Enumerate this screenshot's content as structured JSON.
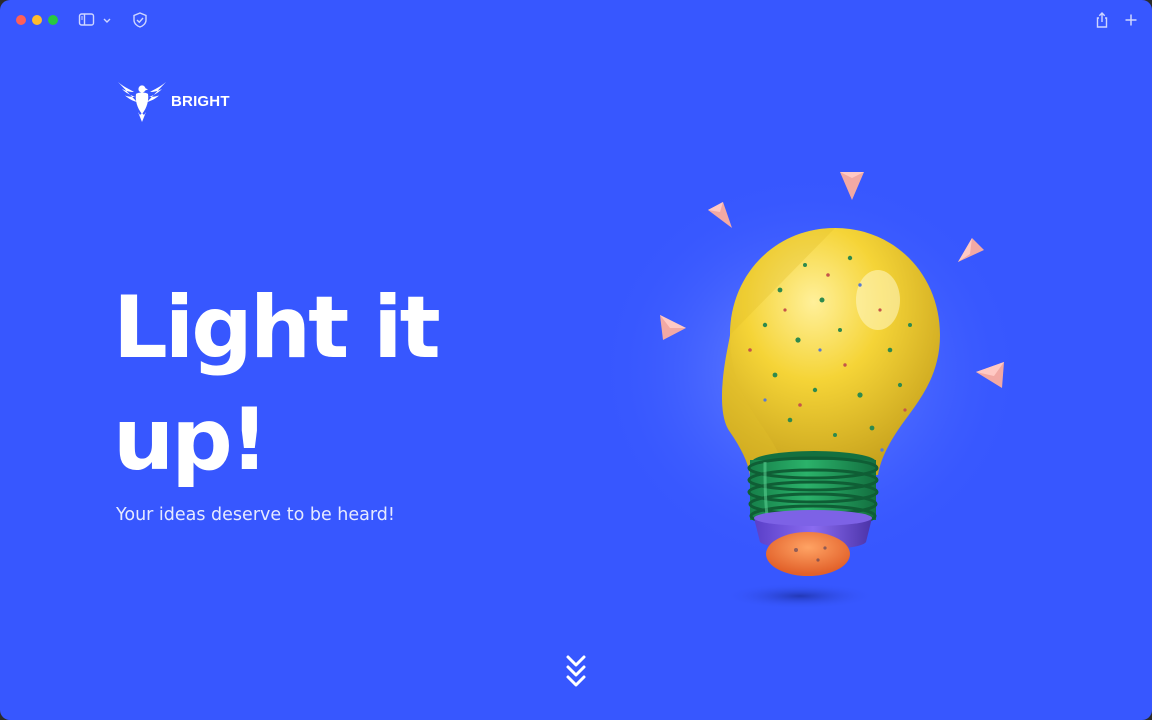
{
  "browser": {
    "traffic_lights": {
      "close": "#FF5F57",
      "minimize": "#FEBC2E",
      "zoom": "#28C840"
    },
    "icons": [
      "sidebar-icon",
      "chevron-down-icon",
      "shield-icon",
      "share-icon",
      "plus-icon"
    ]
  },
  "brand": {
    "name": "BRIGHT",
    "logo_icon": "eagle-icon"
  },
  "hero": {
    "headline_line1": "Light it",
    "headline_line2": "up!",
    "tagline": "Your ideas deserve to be heard!",
    "image_icon": "lightbulb-illustration"
  },
  "scroll": {
    "icon": "triple-chevron-down-icon"
  },
  "colors": {
    "background": "#3757FF",
    "text": "#FFFFFF",
    "bulb": "#F2D03A",
    "bulb_base": "#1F9E57",
    "bulb_cap": "#6A50D8",
    "bulb_tip": "#F07A3A",
    "shard": "#F2A9A4"
  }
}
